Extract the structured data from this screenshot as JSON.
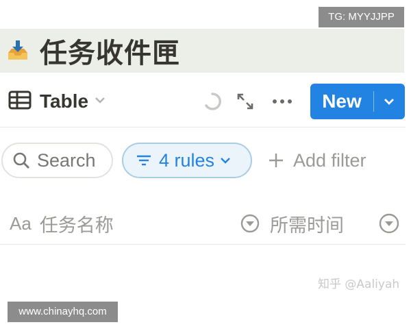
{
  "watermark_top": "TG: MYYJJPP",
  "page": {
    "title": "任务收件匣",
    "icon": "inbox-tray-icon"
  },
  "toolbar": {
    "view_label": "Table",
    "view_icon": "table-icon",
    "new_label": "New"
  },
  "filters": {
    "search_label": "Search",
    "rules_label": "4 rules",
    "add_filter_label": "Add filter"
  },
  "columns": [
    {
      "type_icon": "Aa",
      "label": "任务名称"
    },
    {
      "type_icon": "select-icon",
      "label": "所需时间"
    }
  ],
  "watermark_author": "知乎 @Aaliyah",
  "watermark_site": "www.chinayhq.com",
  "colors": {
    "accent": "#2383e2",
    "title_band": "#eceee8",
    "rules_fill": "#eaf4fa"
  }
}
